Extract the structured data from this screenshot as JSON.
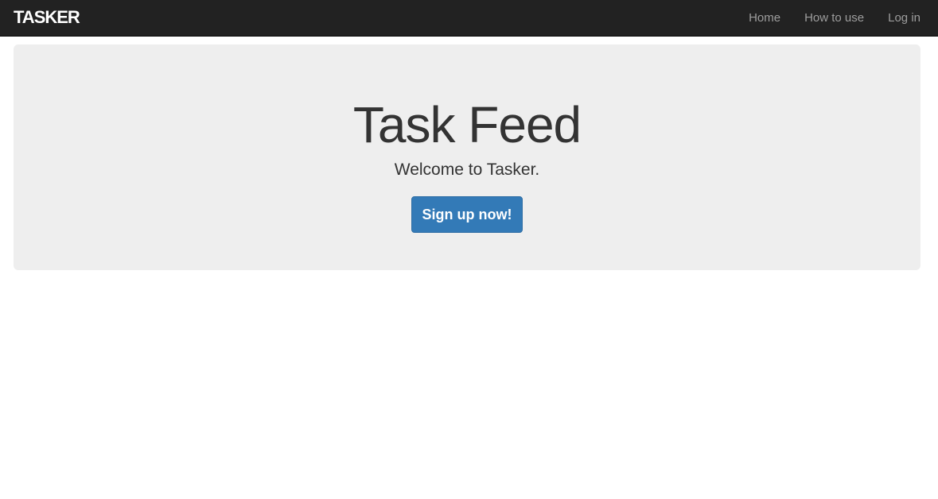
{
  "navbar": {
    "brand": "TASKER",
    "links": [
      {
        "label": "Home"
      },
      {
        "label": "How to use"
      },
      {
        "label": "Log in"
      }
    ]
  },
  "hero": {
    "title": "Task Feed",
    "subtitle": "Welcome to Tasker.",
    "cta_label": "Sign up now!"
  },
  "colors": {
    "navbar_bg": "#222222",
    "nav_link": "#9d9d9d",
    "jumbotron_bg": "#eeeeee",
    "primary_button": "#337ab7",
    "text": "#333333"
  }
}
